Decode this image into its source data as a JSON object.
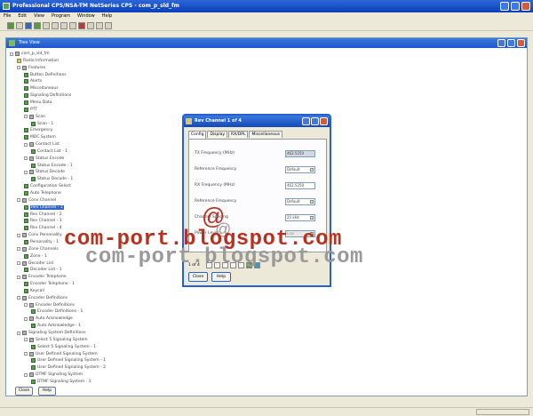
{
  "app": {
    "title": "Professional CPS/NSA-TM NetSeries CPS - com_p_sld_fm",
    "menu": [
      "File",
      "Edit",
      "View",
      "Program",
      "Window",
      "Help"
    ]
  },
  "mdi": {
    "title": "Tree View"
  },
  "tree": [
    {
      "label": "com_p_sld_fm",
      "depth": 0,
      "icon": "d",
      "pm": true
    },
    {
      "label": "Radio Information",
      "depth": 1,
      "icon": "y"
    },
    {
      "label": "Features",
      "depth": 1,
      "icon": "d",
      "pm": true
    },
    {
      "label": "Button Definitions",
      "depth": 2,
      "icon": "g"
    },
    {
      "label": "Alerts",
      "depth": 2,
      "icon": "g"
    },
    {
      "label": "Miscellaneous",
      "depth": 2,
      "icon": "g"
    },
    {
      "label": "Signaling Definitions",
      "depth": 2,
      "icon": "g"
    },
    {
      "label": "Menu Data",
      "depth": 2,
      "icon": "g"
    },
    {
      "label": "PTT",
      "depth": 2,
      "icon": "g"
    },
    {
      "label": "Scan",
      "depth": 2,
      "icon": "d",
      "pm": true
    },
    {
      "label": "Scan - 1",
      "depth": 3,
      "icon": "g"
    },
    {
      "label": "Emergency",
      "depth": 2,
      "icon": "g"
    },
    {
      "label": "MDC System",
      "depth": 2,
      "icon": "g"
    },
    {
      "label": "Contact List",
      "depth": 2,
      "icon": "d",
      "pm": true
    },
    {
      "label": "Contact List - 1",
      "depth": 3,
      "icon": "g"
    },
    {
      "label": "Status Encode",
      "depth": 2,
      "icon": "d",
      "pm": true
    },
    {
      "label": "Status Encode - 1",
      "depth": 3,
      "icon": "g"
    },
    {
      "label": "Status Decode",
      "depth": 2,
      "icon": "d",
      "pm": true
    },
    {
      "label": "Status Decode - 1",
      "depth": 3,
      "icon": "g"
    },
    {
      "label": "Configuration Select",
      "depth": 2,
      "icon": "g"
    },
    {
      "label": "Auto Telephone",
      "depth": 2,
      "icon": "g"
    },
    {
      "label": "Conv Channel",
      "depth": 1,
      "icon": "d",
      "pm": true
    },
    {
      "label": "Rev Channel - 1",
      "depth": 2,
      "icon": "g",
      "selected": true
    },
    {
      "label": "Rev Channel - 2",
      "depth": 2,
      "icon": "g"
    },
    {
      "label": "Rev Channel - 3",
      "depth": 2,
      "icon": "g"
    },
    {
      "label": "Rev Channel - 4",
      "depth": 2,
      "icon": "g"
    },
    {
      "label": "Conv Personality",
      "depth": 1,
      "icon": "d",
      "pm": true
    },
    {
      "label": "Personality - 1",
      "depth": 2,
      "icon": "g"
    },
    {
      "label": "Zone Channels",
      "depth": 1,
      "icon": "d",
      "pm": true
    },
    {
      "label": "Zone - 1",
      "depth": 2,
      "icon": "g"
    },
    {
      "label": "Decoder List",
      "depth": 1,
      "icon": "d",
      "pm": true
    },
    {
      "label": "Decoder List - 1",
      "depth": 2,
      "icon": "g"
    },
    {
      "label": "Encoder Telephone",
      "depth": 1,
      "icon": "d",
      "pm": true
    },
    {
      "label": "Encoder Telephone - 1",
      "depth": 2,
      "icon": "g"
    },
    {
      "label": "Keycall",
      "depth": 2,
      "icon": "g"
    },
    {
      "label": "Encoder Definitions",
      "depth": 1,
      "icon": "d",
      "pm": true
    },
    {
      "label": "Encoder Definitions",
      "depth": 2,
      "icon": "d",
      "pm": true
    },
    {
      "label": "Encoder Definitions - 1",
      "depth": 3,
      "icon": "g"
    },
    {
      "label": "Auto Acknowledge",
      "depth": 2,
      "icon": "d",
      "pm": true
    },
    {
      "label": "Auto Acknowledge - 1",
      "depth": 3,
      "icon": "g"
    },
    {
      "label": "Signaling System Definitions",
      "depth": 1,
      "icon": "d",
      "pm": true
    },
    {
      "label": "Select 5 Signaling System",
      "depth": 2,
      "icon": "d",
      "pm": true
    },
    {
      "label": "Select 5 Signaling System - 1",
      "depth": 3,
      "icon": "g"
    },
    {
      "label": "User Defined Signaling System",
      "depth": 2,
      "icon": "d",
      "pm": true
    },
    {
      "label": "User Defined Signaling System - 1",
      "depth": 3,
      "icon": "g"
    },
    {
      "label": "User Defined Signaling System - 2",
      "depth": 3,
      "icon": "g"
    },
    {
      "label": "DTMF Signaling System",
      "depth": 2,
      "icon": "d",
      "pm": true
    },
    {
      "label": "DTMF Signaling System - 1",
      "depth": 3,
      "icon": "g"
    }
  ],
  "bottom_buttons": {
    "close": "Close",
    "help": "Help"
  },
  "dialog": {
    "title": "Rev Channel 1 of 4",
    "tabs": [
      "Config",
      "Display",
      "RX/DPL",
      "Miscellaneous"
    ],
    "rows": [
      {
        "label": "TX Frequency (MHz)",
        "value": "462.5250",
        "selected": true
      },
      {
        "label": "Reference Frequency",
        "value": "Default",
        "dropdown": true
      },
      {
        "label": "RX Frequency (MHz)",
        "value": "462.5250"
      },
      {
        "label": "Reference Frequency",
        "value": "Default",
        "dropdown": true
      },
      {
        "label": "Channel Spacing",
        "value": "25 kHz",
        "dropdown": true
      },
      {
        "label": "Power Level",
        "value": "Low",
        "dropdown": true,
        "disabled": true
      }
    ],
    "record_count": "1 of 4",
    "buttons": {
      "close": "Close",
      "help": "Help"
    }
  },
  "watermark": {
    "at": "@",
    "text": "com-port.blogspot.com"
  }
}
